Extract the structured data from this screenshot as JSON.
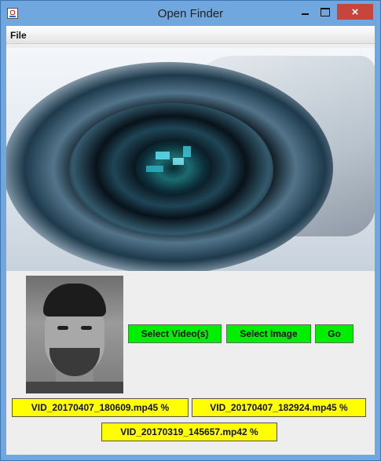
{
  "window": {
    "title": "Open Finder",
    "close_glyph": "×",
    "accent": "#70a7df",
    "close_color": "#c8453b"
  },
  "menu": {
    "file_label": "File"
  },
  "controls": {
    "select_videos_label": "Select Video(s)",
    "select_image_label": "Select Image",
    "go_label": "Go",
    "button_color": "#00ee00"
  },
  "files": [
    {
      "name": "VID_20170407_180609.mp4",
      "progress": "5 %"
    },
    {
      "name": "VID_20170407_182924.mp4",
      "progress": "5 %"
    },
    {
      "name": "VID_20170319_145657.mp4",
      "progress": "2 %"
    }
  ],
  "file_chip_color": "#ffff00"
}
